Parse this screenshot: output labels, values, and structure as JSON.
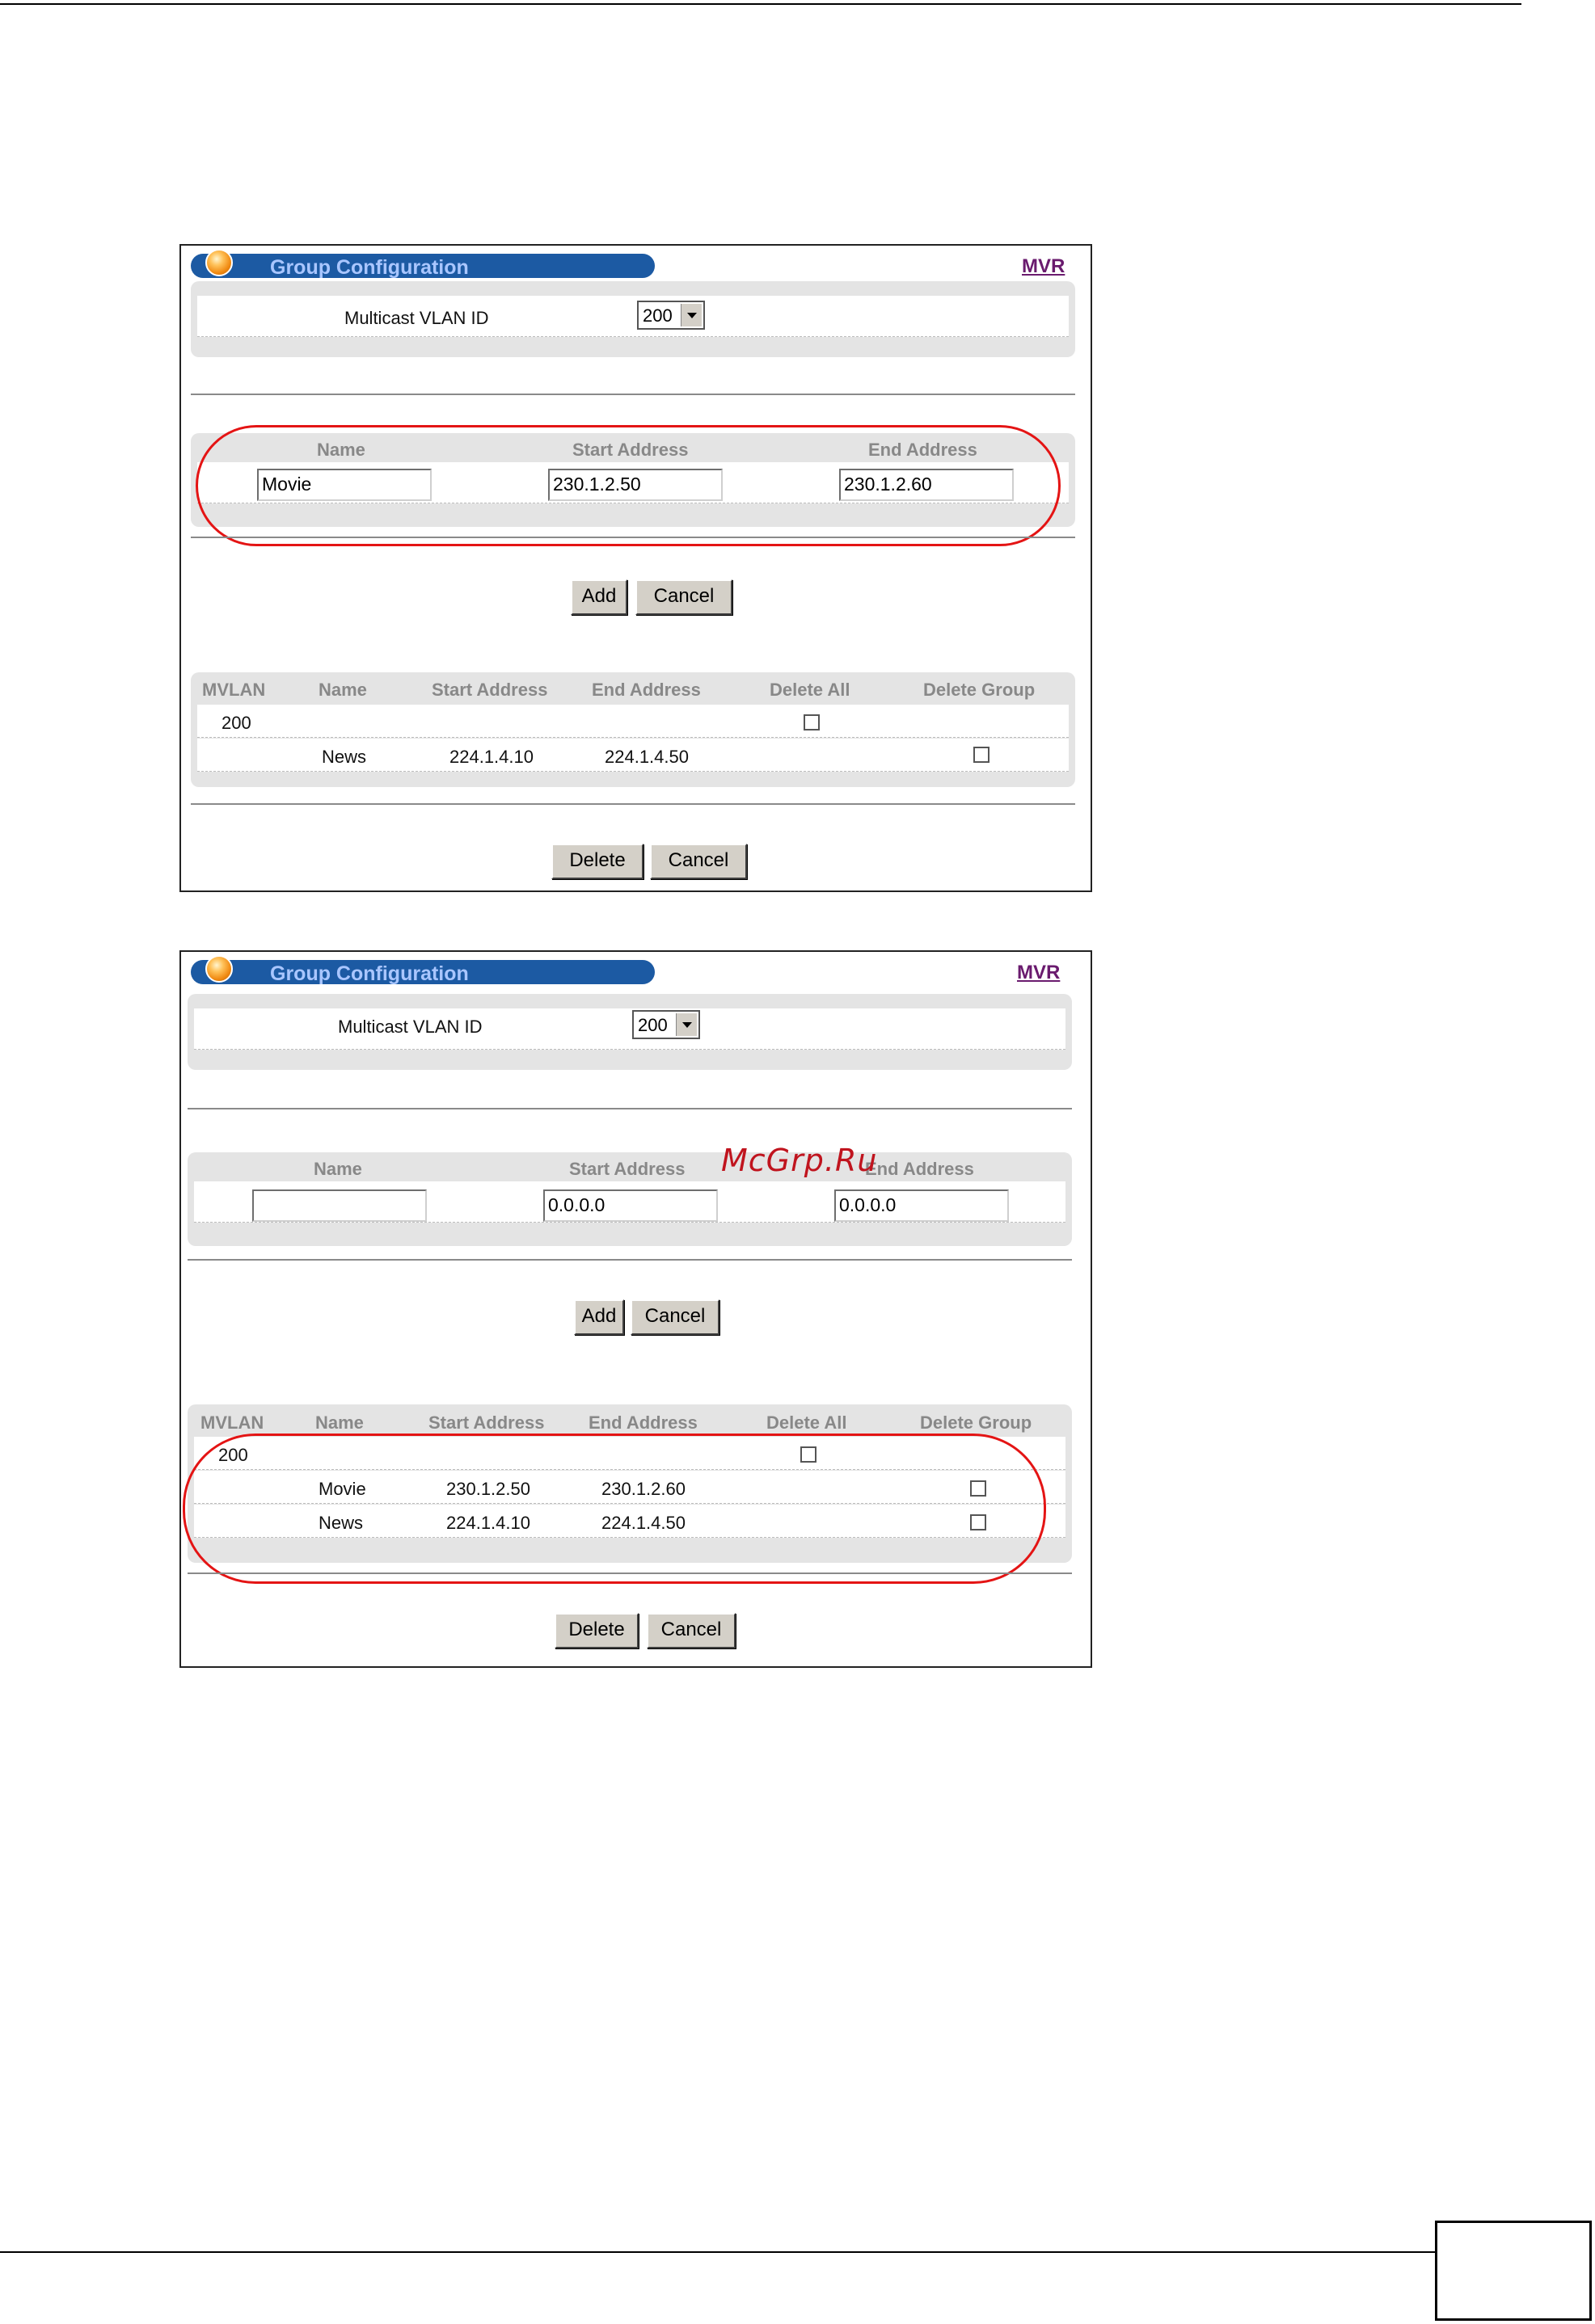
{
  "screens": [
    {
      "title": "Group Configuration",
      "mvr_link": "MVR",
      "vlan_label": "Multicast VLAN ID",
      "vlan_value": "200",
      "form_headers": [
        "Name",
        "Start Address",
        "End Address"
      ],
      "form_values": [
        "Movie",
        "230.1.2.50",
        "230.1.2.60"
      ],
      "add_label": "Add",
      "cancel_label": "Cancel",
      "table_headers": [
        "MVLAN",
        "Name",
        "Start Address",
        "End Address",
        "Delete All",
        "Delete Group"
      ],
      "mvlan": "200",
      "rows": [
        {
          "name": "News",
          "start": "224.1.4.10",
          "end": "224.1.4.50"
        }
      ],
      "delete_label": "Delete",
      "cancel2_label": "Cancel"
    },
    {
      "title": "Group Configuration",
      "mvr_link": "MVR",
      "vlan_label": "Multicast VLAN ID",
      "vlan_value": "200",
      "form_headers": [
        "Name",
        "Start Address",
        "End Address"
      ],
      "form_values": [
        "",
        "0.0.0.0",
        "0.0.0.0"
      ],
      "add_label": "Add",
      "cancel_label": "Cancel",
      "table_headers": [
        "MVLAN",
        "Name",
        "Start Address",
        "End Address",
        "Delete All",
        "Delete Group"
      ],
      "mvlan": "200",
      "rows": [
        {
          "name": "Movie",
          "start": "230.1.2.50",
          "end": "230.1.2.60"
        },
        {
          "name": "News",
          "start": "224.1.4.10",
          "end": "224.1.4.50"
        }
      ],
      "delete_label": "Delete",
      "cancel2_label": "Cancel"
    }
  ],
  "watermark": "McGrp.Ru",
  "colors": {
    "title_bar": "#1c5aa3",
    "title_text": "#a9c6ff",
    "callout": "#e41414",
    "link": "#6a1b6e"
  }
}
